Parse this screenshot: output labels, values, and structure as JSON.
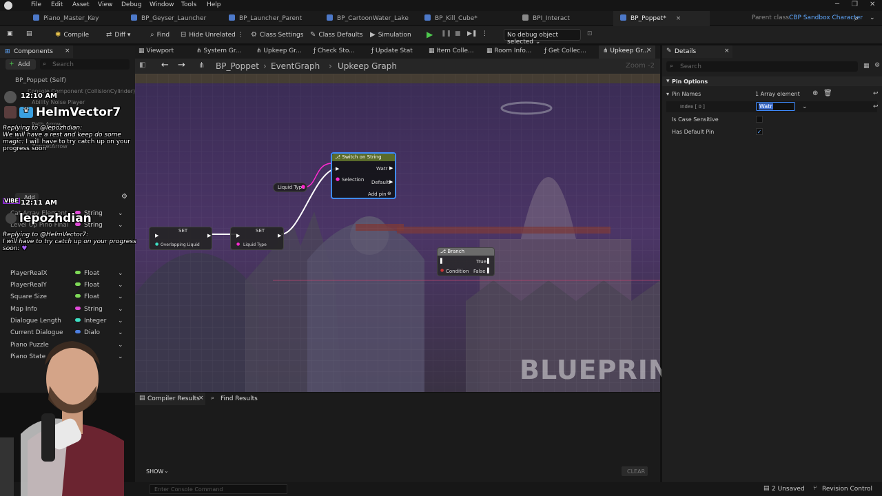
{
  "menu": {
    "items": [
      "File",
      "Edit",
      "Asset",
      "View",
      "Debug",
      "Window",
      "Tools",
      "Help"
    ]
  },
  "tabs": [
    {
      "label": "Piano_Master_Key",
      "close": ""
    },
    {
      "label": "BP_Geyser_Launcher",
      "close": ""
    },
    {
      "label": "BP_Launcher_Parent",
      "close": ""
    },
    {
      "label": "BP_CartoonWater_Lake",
      "close": ""
    },
    {
      "label": "BP_Kill_Cube*",
      "close": ""
    },
    {
      "label": "BPI_Interact",
      "close": ""
    },
    {
      "label": "BP_Poppet*",
      "close": "×"
    }
  ],
  "parent_class": {
    "label": "Parent class:",
    "value": "CBP Sandbox Character"
  },
  "toolbar": {
    "compile": "Compile",
    "diff": "Diff",
    "find": "Find",
    "hide_unrelated": "Hide Unrelated",
    "class_settings": "Class Settings",
    "class_defaults": "Class Defaults",
    "simulation": "Simulation",
    "debug_object": "No debug object selected"
  },
  "left": {
    "tab": "Components",
    "add": "Add",
    "search_placeholder": "Search",
    "self": "BP_Poppet (Self)",
    "component1": "Console Component (CollisionCylinder)",
    "component2": "Ability Noise Player",
    "component3": "Path Arrow",
    "component4": "ZoppetArrow",
    "vars_add": "Add",
    "var_rows": [
      {
        "name": "Cat Array Element",
        "type": "String",
        "color": "#e04ad8"
      },
      {
        "name": "Level Up Pino Final",
        "type": "String",
        "color": "#e04ad8"
      },
      {
        "name": "PlayerRealX",
        "type": "Float",
        "color": "#7ed957"
      },
      {
        "name": "PlayerRealY",
        "type": "Float",
        "color": "#7ed957"
      },
      {
        "name": "Square Size",
        "type": "Float",
        "color": "#7ed957"
      },
      {
        "name": "Map Info",
        "type": "String",
        "color": "#e04ad8"
      },
      {
        "name": "Dialogue Length",
        "type": "Integer",
        "color": "#3ee0c4"
      },
      {
        "name": "Current Dialogue",
        "type": "Dialo",
        "color": "#4d7fe0"
      },
      {
        "name": "Piano Puzzle",
        "type": "",
        "color": "#aaa"
      },
      {
        "name": "Piano State",
        "type": "",
        "color": "#aaa"
      }
    ]
  },
  "graph_tabs": [
    "Viewport",
    "System Gr...",
    "Upkeep Gr...",
    "Check Sto...",
    "Update Stat",
    "Item Colle...",
    "Room Info...",
    "Get Collec...",
    "Upkeep Gr..."
  ],
  "breadcrumb": {
    "root": "BP_Poppet",
    "mid": "EventGraph",
    "leaf": "Upkeep Graph",
    "zoom": "Zoom -2"
  },
  "nodes": {
    "switch": {
      "title": "Switch on String",
      "selection": "Selection",
      "out1": "Watr",
      "default": "Default",
      "add_pin": "Add pin"
    },
    "liquid_type_getter": "Liquid Type",
    "set1": {
      "title": "SET",
      "pin": "Overlapping Liquid"
    },
    "set2": {
      "title": "SET",
      "pin": "Liquid Type"
    },
    "branch": {
      "title": "Branch",
      "true": "True",
      "condition": "Condition",
      "false": "False"
    }
  },
  "watermark": "BLUEPRINT",
  "details": {
    "tab": "Details",
    "search_placeholder": "Search",
    "section": "Pin Options",
    "pin_names_label": "Pin Names",
    "pin_names_value": "1 Array element",
    "index_label": "Index [ 0 ]",
    "index_value": "Watr",
    "case_sensitive": "Is Case Sensitive",
    "has_default": "Has Default Pin"
  },
  "bottom": {
    "compiler_results": "Compiler Results",
    "find_results": "Find Results",
    "show": "SHOW",
    "clear": "CLEAR",
    "console_placeholder": "Enter Console Command"
  },
  "status": {
    "unsaved": "2 Unsaved",
    "revision": "Revision Control"
  },
  "chat": {
    "time1": "12:10 AM",
    "user1": "HelmVector7",
    "msg1_reply": "Replying to @lepozhdian:",
    "msg1_quote": "We will have a rest and keep do some magic:",
    "msg1_text": "I will have to try catch up on your progress soon",
    "time2": "12:11 AM",
    "user2": "lepozhdian",
    "msg2_reply": "Replying to @HelmVector7:",
    "msg2_quote": "I will have to try catch up on your progress soon:"
  }
}
